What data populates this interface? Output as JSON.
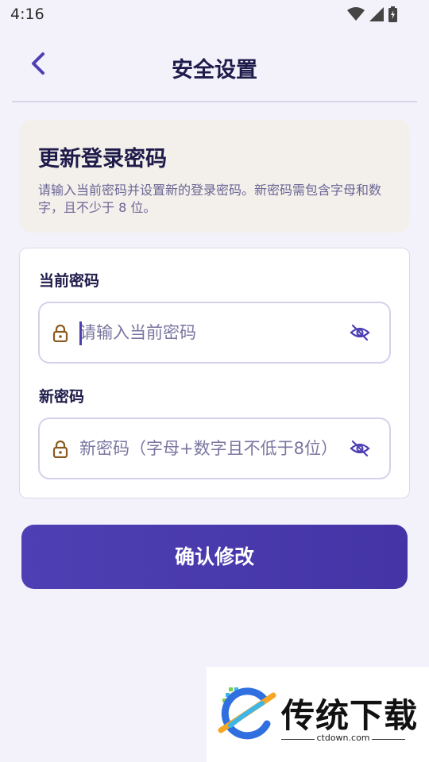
{
  "status_bar": {
    "time": "4:16",
    "icons": [
      "wifi-icon",
      "signal-icon",
      "battery-icon"
    ]
  },
  "header": {
    "title": "安全设置",
    "back_icon": "chevron-left-icon"
  },
  "info_card": {
    "title": "更新登录密码",
    "description": "请输入当前密码并设置新的登录密码。新密码需包含字母和数字，且不少于 8 位。"
  },
  "form": {
    "current_password": {
      "label": "当前密码",
      "placeholder": "请输入当前密码",
      "value": ""
    },
    "new_password": {
      "label": "新密码",
      "placeholder": "新密码（字母+数字且不低于8位）",
      "value": ""
    }
  },
  "actions": {
    "confirm_label": "确认修改"
  },
  "watermark": {
    "brand": "传统下载",
    "url": "ctdown.com"
  },
  "colors": {
    "accent": "#4e3fb4",
    "background": "#f3f2fa",
    "info_card_bg": "#f3efea",
    "lock_icon": "#8a5a1c"
  }
}
